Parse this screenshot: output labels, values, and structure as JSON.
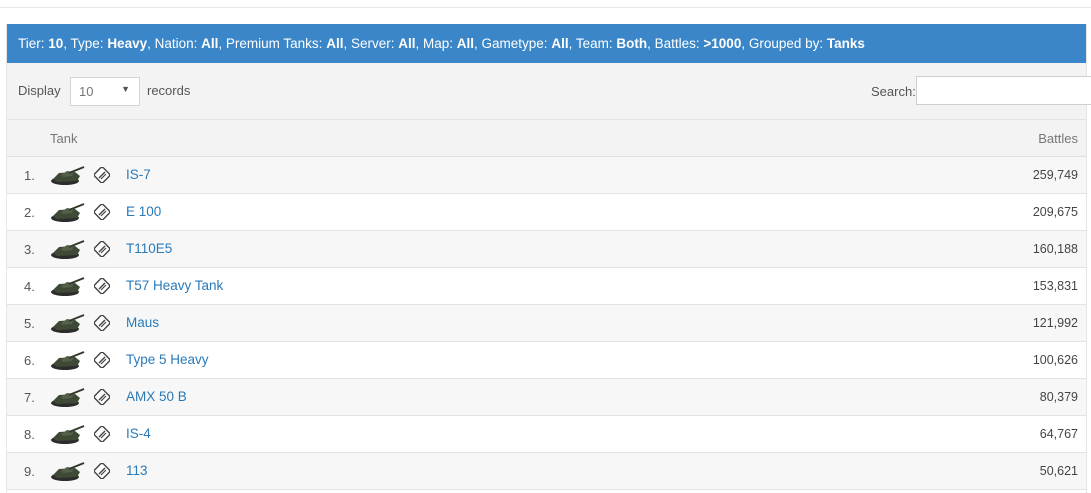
{
  "filters": {
    "tier_label": "Tier: ",
    "tier": "10",
    "type_label": ", Type: ",
    "type": "Heavy",
    "nation_label": ", Nation: ",
    "nation": "All",
    "premium_label": ", Premium Tanks: ",
    "premium": "All",
    "server_label": ", Server: ",
    "server": "All",
    "map_label": ", Map: ",
    "map": "All",
    "gametype_label": ", Gametype: ",
    "gametype": "All",
    "team_label": ", Team: ",
    "team": "Both",
    "battles_label": ", Battles: ",
    "battles": ">1000",
    "grouped_label": ", Grouped by: ",
    "grouped": "Tanks"
  },
  "controls": {
    "display_label": "Display",
    "records_value": "10",
    "records_label": "records",
    "search_label": "Search:",
    "search_value": ""
  },
  "table": {
    "col_tank": "Tank",
    "col_battles": "Battles",
    "rows": [
      {
        "rank": "1.",
        "name": "IS-7",
        "battles": "259,749"
      },
      {
        "rank": "2.",
        "name": "E 100",
        "battles": "209,675"
      },
      {
        "rank": "3.",
        "name": "T110E5",
        "battles": "160,188"
      },
      {
        "rank": "4.",
        "name": "T57 Heavy Tank",
        "battles": "153,831"
      },
      {
        "rank": "5.",
        "name": "Maus",
        "battles": "121,992"
      },
      {
        "rank": "6.",
        "name": "Type 5 Heavy",
        "battles": "100,626"
      },
      {
        "rank": "7.",
        "name": "AMX 50 B",
        "battles": "80,379"
      },
      {
        "rank": "8.",
        "name": "IS-4",
        "battles": "64,767"
      },
      {
        "rank": "9.",
        "name": "113",
        "battles": "50,621"
      }
    ]
  },
  "colors": {
    "header_blue": "#3a86c8",
    "link_blue": "#2a7ab8"
  }
}
